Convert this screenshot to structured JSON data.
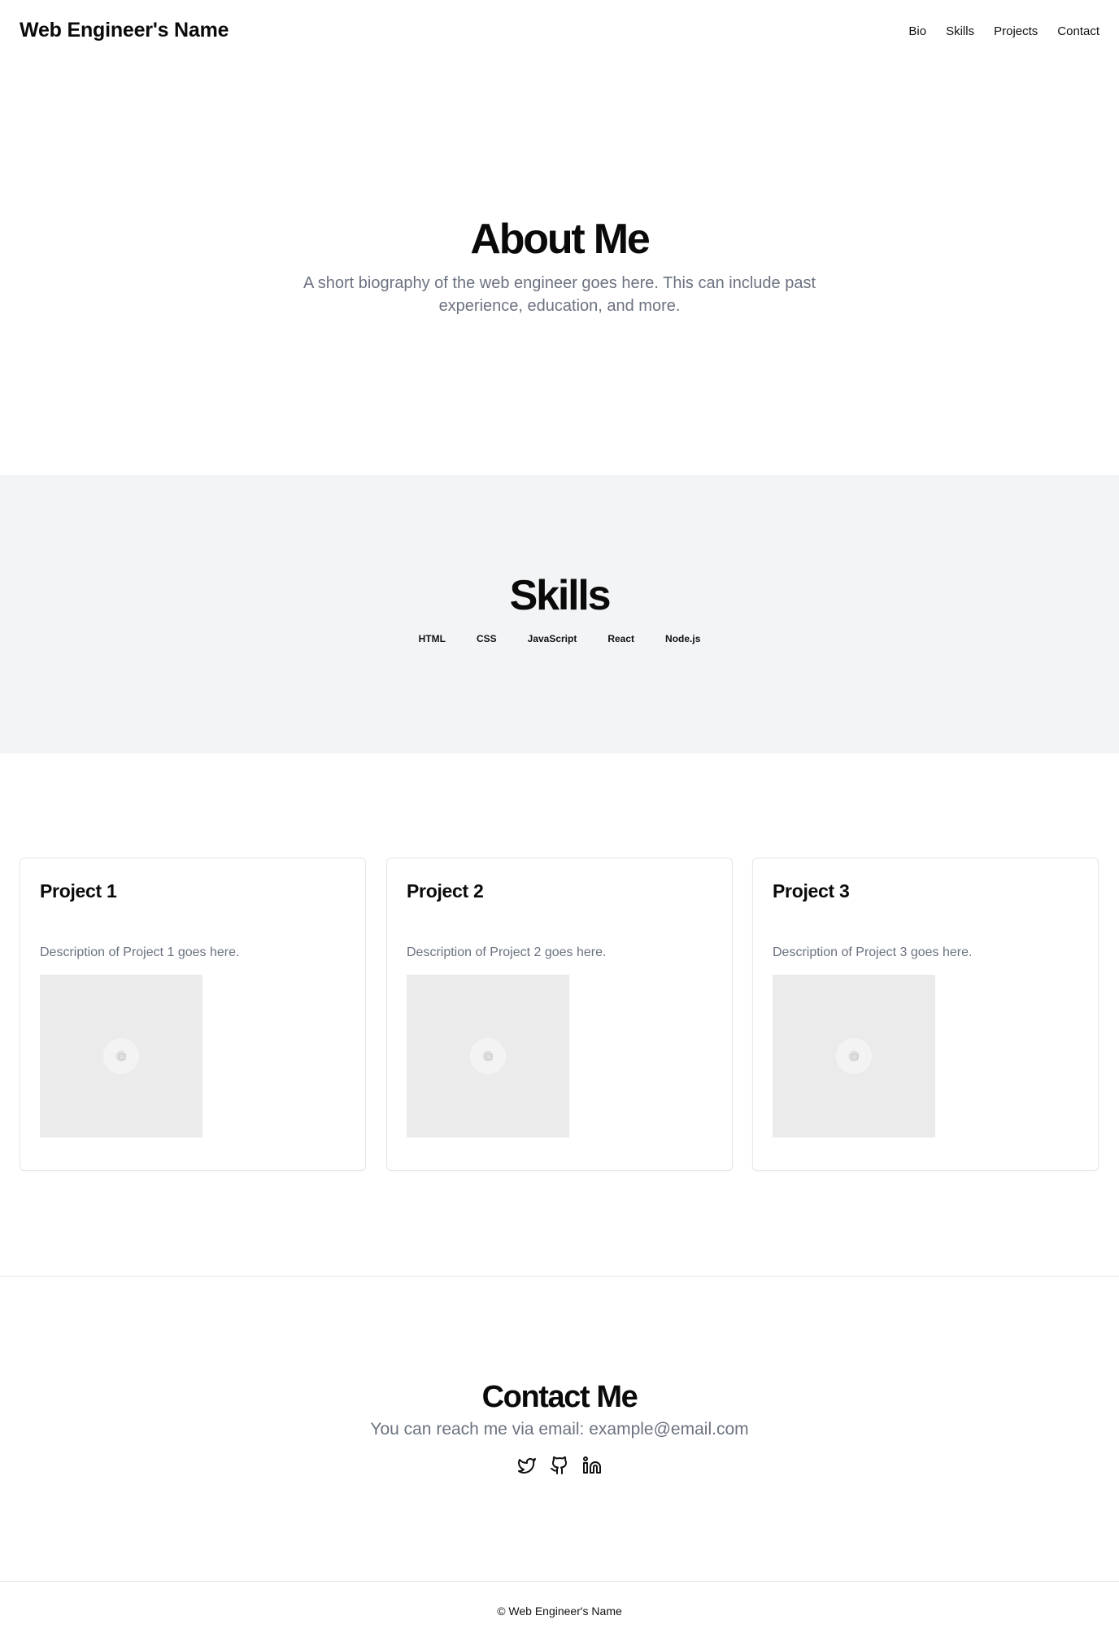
{
  "header": {
    "brand": "Web Engineer's Name",
    "nav": [
      "Bio",
      "Skills",
      "Projects",
      "Contact"
    ]
  },
  "about": {
    "title": "About Me",
    "text": "A short biography of the web engineer goes here. This can include past experience, education, and more."
  },
  "skills": {
    "title": "Skills",
    "items": [
      "HTML",
      "CSS",
      "JavaScript",
      "React",
      "Node.js"
    ]
  },
  "projects": [
    {
      "title": "Project 1",
      "description": "Description of Project 1 goes here."
    },
    {
      "title": "Project 2",
      "description": "Description of Project 2 goes here."
    },
    {
      "title": "Project 3",
      "description": "Description of Project 3 goes here."
    }
  ],
  "contact": {
    "title": "Contact Me",
    "text": "You can reach me via email: example@email.com",
    "socials": [
      "twitter-icon",
      "github-icon",
      "linkedin-icon"
    ]
  },
  "footer": {
    "copyright": "© Web Engineer's Name"
  }
}
